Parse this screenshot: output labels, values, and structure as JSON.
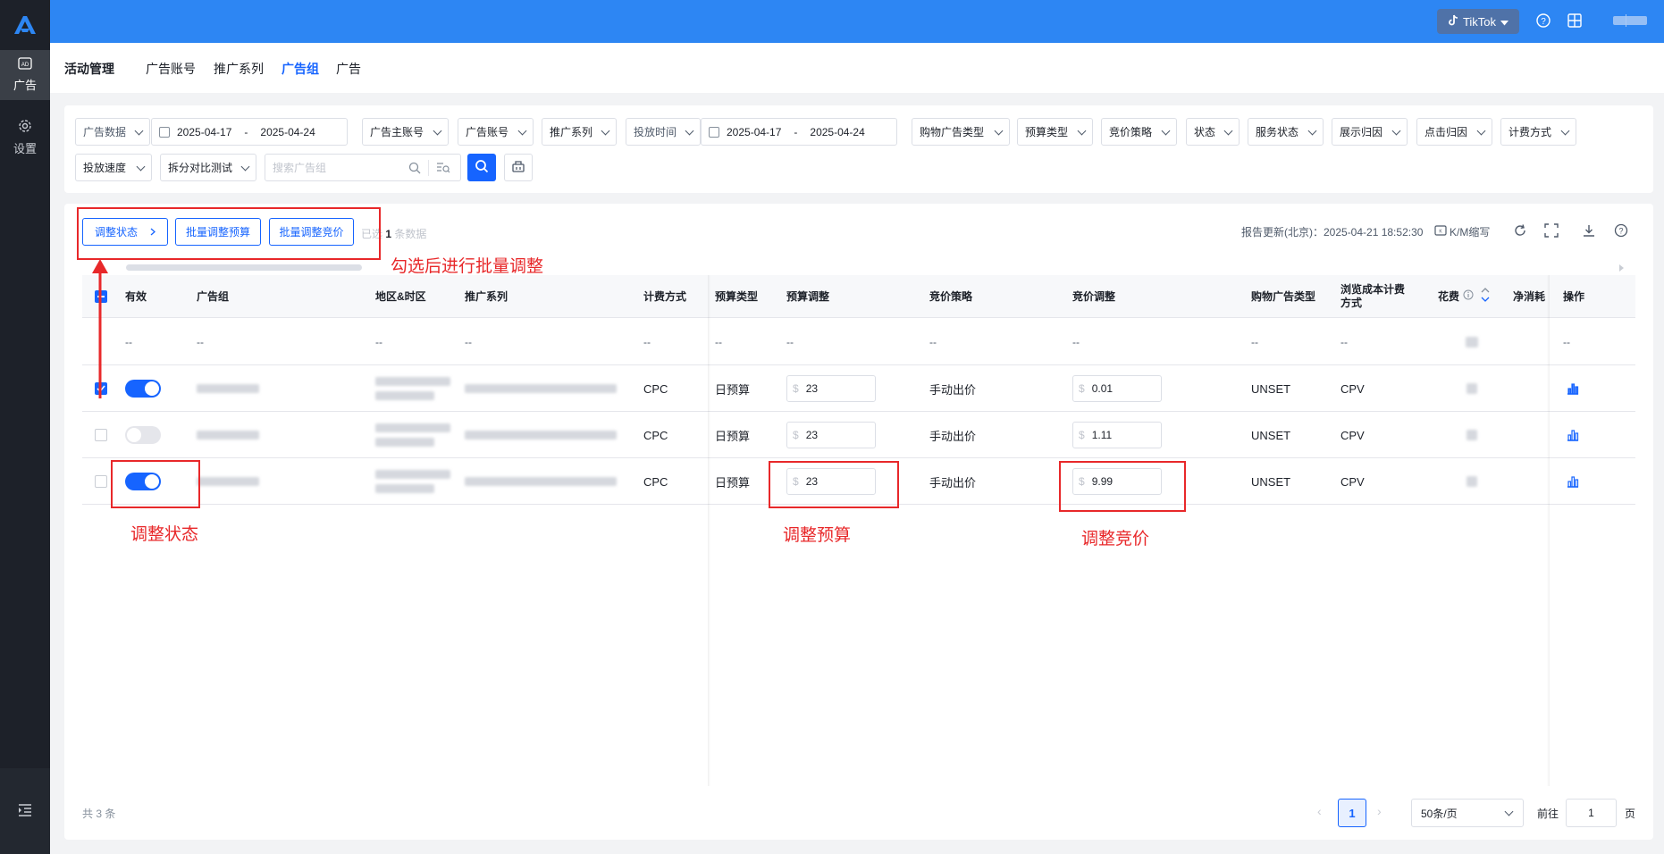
{
  "sidebar": {
    "items": [
      {
        "label": "广告",
        "icon": "ad-icon"
      },
      {
        "label": "设置",
        "icon": "gear-icon"
      }
    ],
    "bottom_icon": "collapse-menu-icon"
  },
  "topbar": {
    "platform": "TikTok",
    "accent": "#2d86f3"
  },
  "breadcrumb": {
    "items": [
      "活动管理",
      "广告账号",
      "推广系列",
      "广告组",
      "广告"
    ],
    "active_index": 3
  },
  "filters": {
    "row1": [
      {
        "label": "广告数据"
      },
      {
        "label": "广告主账号"
      },
      {
        "label": "广告账号"
      },
      {
        "label": "推广系列"
      },
      {
        "label": "投放时间"
      },
      {
        "label": "购物广告类型"
      },
      {
        "label": "预算类型"
      },
      {
        "label": "竞价策略"
      },
      {
        "label": "状态"
      },
      {
        "label": "服务状态"
      },
      {
        "label": "展示归因"
      },
      {
        "label": "点击归因"
      },
      {
        "label": "计费方式"
      }
    ],
    "date_range_1": {
      "start": "2025-04-17",
      "sep": "-",
      "end": "2025-04-24"
    },
    "date_range_2": {
      "start": "2025-04-17",
      "sep": "-",
      "end": "2025-04-24"
    },
    "row2": [
      {
        "label": "投放速度"
      },
      {
        "label": "拆分对比测试"
      }
    ],
    "search_placeholder": "搜索广告组"
  },
  "toolbar": {
    "adjust_status": "调整状态",
    "batch_budget": "批量调整预算",
    "batch_bid": "批量调整竞价",
    "selected_prefix": "已选",
    "selected_count": "1",
    "selected_suffix": "条数据",
    "report_update": "报告更新(北京)：2025-04-21 18:52:30",
    "km_label": "K/M缩写"
  },
  "table": {
    "headers": {
      "active": "有效",
      "adgroup": "广告组",
      "region": "地区&时区",
      "campaign": "推广系列",
      "billing": "计费方式",
      "budget_type": "预算类型",
      "budget_adjust": "预算调整",
      "bid_strategy": "竞价策略",
      "bid_adjust": "竞价调整",
      "shopping_type": "购物广告类型",
      "view_cost": "浏览成本计费方式",
      "spend": "花费",
      "net_spend": "净消耗",
      "ops": "操作"
    },
    "summary_dash": "--",
    "rows": [
      {
        "checked": true,
        "active": true,
        "billing": "CPC",
        "budget_type": "日预算",
        "currency": "$",
        "budget": "23",
        "bid_strategy": "手动出价",
        "bid": "0.01",
        "shopping_type": "UNSET",
        "view_cost": "CPV"
      },
      {
        "checked": false,
        "active": false,
        "billing": "CPC",
        "budget_type": "日预算",
        "currency": "$",
        "budget": "23",
        "bid_strategy": "手动出价",
        "bid": "1.11",
        "shopping_type": "UNSET",
        "view_cost": "CPV"
      },
      {
        "checked": false,
        "active": true,
        "billing": "CPC",
        "budget_type": "日预算",
        "currency": "$",
        "budget": "23",
        "bid_strategy": "手动出价",
        "bid": "9.99",
        "shopping_type": "UNSET",
        "view_cost": "CPV"
      }
    ]
  },
  "annotations": {
    "batch_note": "勾选后进行批量调整",
    "status_note": "调整状态",
    "budget_note": "调整预算",
    "bid_note": "调整竞价",
    "color": "#e8282a"
  },
  "pagination": {
    "total": "共 3 条",
    "current_page": "1",
    "page_size": "50条/页",
    "goto_label": "前往",
    "goto_value": "1",
    "goto_suffix": "页"
  }
}
